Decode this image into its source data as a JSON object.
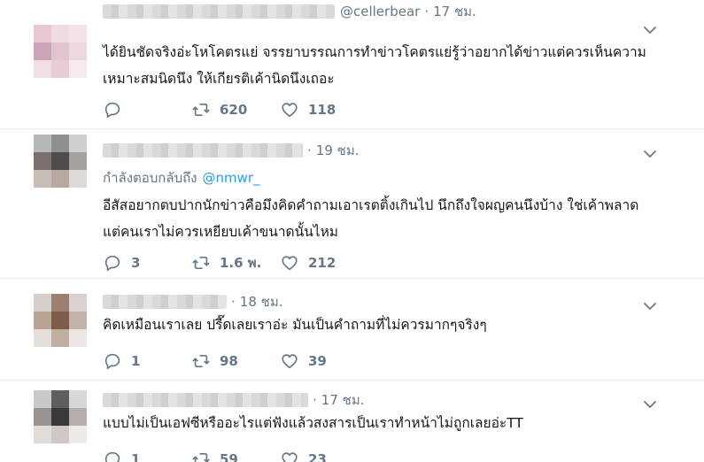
{
  "tweets": [
    {
      "handle": "@cellerbear",
      "time": "17 ชม.",
      "replying_label": "",
      "replying_handle": "",
      "text": "ได้ยินชัดจริงอ่ะโหโคตรแย่ จรรยาบรรณการทำข่าวโคตรแย่รู้ว่าอยากได้ข่าวแต่ควรเห็นความเหมาะสมนิดนึง ให้เกียรติเค้านิดนึงเถอะ",
      "replies": "",
      "retweets": "620",
      "likes": "118"
    },
    {
      "handle": "",
      "time": "19 ชม.",
      "replying_label": "กำลังตอบกลับถึง",
      "replying_handle": "@nmwr_",
      "text": "อีสัสอยากตบปากนักข่าวคือมึงคิดคำถามเอาเรตติ้งเกินไป นึกถึงใจผญคนนึงบ้าง ใช่เค้าพลาดแต่คนเราไม่ควรเหยียบเค้าขนาดนั้นไหม",
      "replies": "3",
      "retweets": "1.6 พ.",
      "likes": "212"
    },
    {
      "handle": "",
      "time": "18 ชม.",
      "replying_label": "",
      "replying_handle": "",
      "text": "คิดเหมือนเราเลย ปรี๊ดเลยเราอ่ะ มันเป็นคำถามที่ไม่ควรมากๆจริงๆ",
      "replies": "1",
      "retweets": "98",
      "likes": "39"
    },
    {
      "handle": "",
      "time": "17 ชม.",
      "replying_label": "",
      "replying_handle": "",
      "text": "แบบไม่เป็นเอฟซีหรืออะไรแต่ฟังแล้วสงสารเป็นเราทำหน้าไม่ถูกเลยอ่ะTT",
      "replies": "1",
      "retweets": "59",
      "likes": "23"
    }
  ],
  "colors": {
    "text": "#14171a",
    "muted": "#657786",
    "link": "#1da1f2",
    "divider": "#e6ecf0"
  },
  "icons": [
    "reply-icon",
    "retweet-icon",
    "like-icon",
    "chevron-down-icon"
  ]
}
